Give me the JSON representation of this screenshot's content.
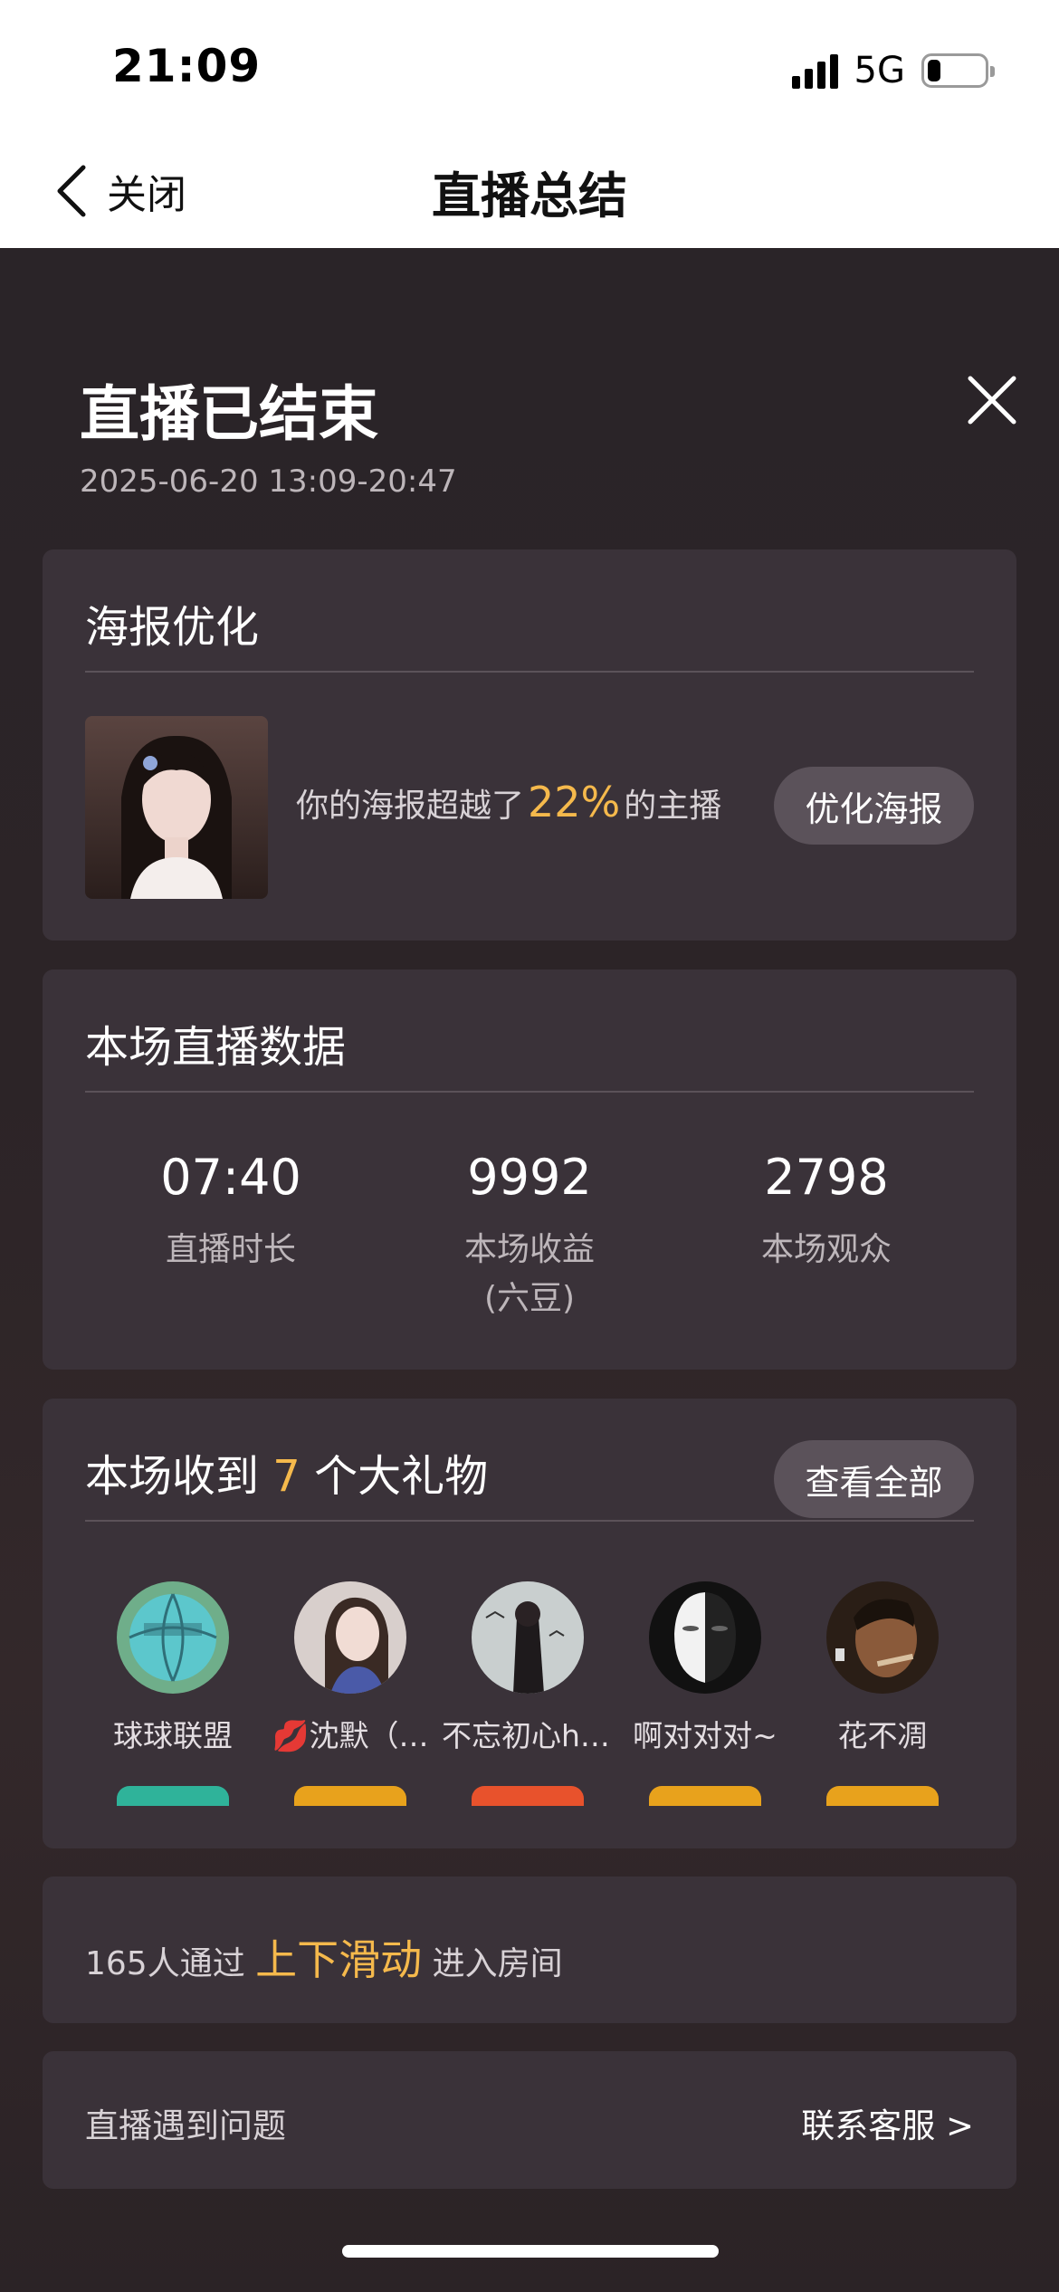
{
  "status_bar": {
    "time": "21:09",
    "network": "5G"
  },
  "nav": {
    "back_label": "关闭",
    "title": "直播总结"
  },
  "summary": {
    "title": "直播已结束",
    "time_range": "2025-06-20 13:09-20:47"
  },
  "poster": {
    "title": "海报优化",
    "text_before": "你的海报超越了",
    "percent": "22%",
    "text_after": "的主播",
    "button": "优化海报"
  },
  "live_data": {
    "title": "本场直播数据",
    "stats": [
      {
        "value": "07:40",
        "label": "直播时长",
        "sub": ""
      },
      {
        "value": "9992",
        "label": "本场收益",
        "sub": "(六豆)"
      },
      {
        "value": "2798",
        "label": "本场观众",
        "sub": ""
      }
    ]
  },
  "gifts": {
    "title_before": "本场收到",
    "count": "7",
    "title_after": "个大礼物",
    "view_all": "查看全部",
    "gifters": [
      {
        "name": "球球联盟",
        "avatar": "basketball",
        "badge_color": "#2fb39a"
      },
      {
        "name": "💋沈默（…",
        "avatar": "woman-portrait",
        "badge_color": "#e8a21c"
      },
      {
        "name": "不忘初心hhx",
        "avatar": "woman-back",
        "badge_color": "#e8522c"
      },
      {
        "name": "啊对对对~",
        "avatar": "mask",
        "badge_color": "#e8a21c"
      },
      {
        "name": "花不凋",
        "avatar": "man-portrait",
        "badge_color": "#e8a21c"
      }
    ]
  },
  "slide": {
    "count_text": "165人通过",
    "highlight": "上下滑动",
    "suffix": "进入房间"
  },
  "issue": {
    "text": "直播遇到问题",
    "contact": "联系客服 >"
  },
  "colors": {
    "accent": "#f5b94c",
    "card": "#3a3239",
    "background": "#2b2326"
  }
}
